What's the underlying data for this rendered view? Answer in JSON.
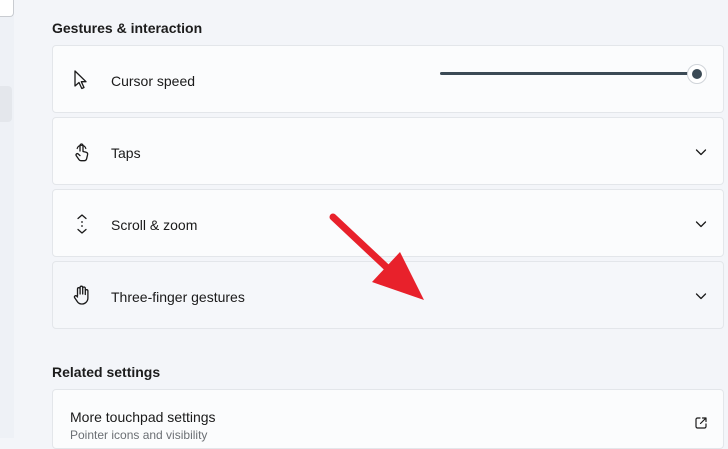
{
  "gestures": {
    "section_title": "Gestures & interaction",
    "cursor_speed": {
      "label": "Cursor speed",
      "icon": "cursor-arrow-icon",
      "slider_level": 1.0
    },
    "items": [
      {
        "label": "Taps",
        "icon": "tap-hand-icon"
      },
      {
        "label": "Scroll & zoom",
        "icon": "scroll-arrows-icon"
      },
      {
        "label": "Three-finger gestures",
        "icon": "hand-icon"
      }
    ]
  },
  "related": {
    "section_title": "Related settings",
    "more_touchpad": {
      "label": "More touchpad settings",
      "description": "Pointer icons and visibility",
      "icon": "open-external-icon"
    }
  },
  "colors": {
    "accent": "#3b4a55",
    "annotation_arrow": "#e8212b"
  }
}
